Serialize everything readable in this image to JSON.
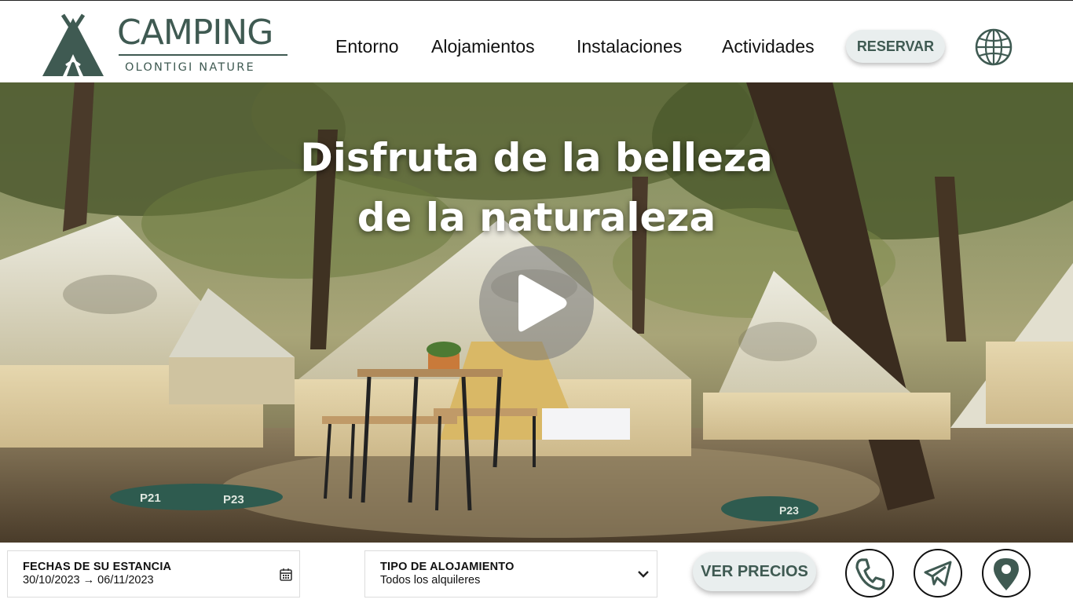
{
  "brand": {
    "title": "CAMPING",
    "subtitle": "OLONTIGI NATURE",
    "color": "#3f5a52"
  },
  "nav": {
    "items": [
      {
        "label": "Entorno"
      },
      {
        "label": "Alojamientos"
      },
      {
        "label": "Instalaciones"
      },
      {
        "label": "Actividades"
      }
    ],
    "reserve_label": "RESERVAR",
    "language_icon": "globe-icon"
  },
  "hero": {
    "title_line1": "Disfruta de la belleza",
    "title_line2": "de la naturaleza",
    "play_icon": "play-icon",
    "image_description_labels": [
      "P21",
      "P23",
      "P23"
    ]
  },
  "booking": {
    "dates": {
      "label": "FECHAS DE SU ESTANCIA",
      "value": "30/10/2023 → 06/11/2023",
      "icon": "calendar-icon"
    },
    "accommodation": {
      "label": "TIPO DE ALOJAMIENTO",
      "value": "Todos los alquileres",
      "icon": "chevron-down-icon"
    },
    "prices_label": "VER PRECIOS",
    "contact_icons": [
      "phone-icon",
      "telegram-icon",
      "location-pin-icon"
    ]
  }
}
